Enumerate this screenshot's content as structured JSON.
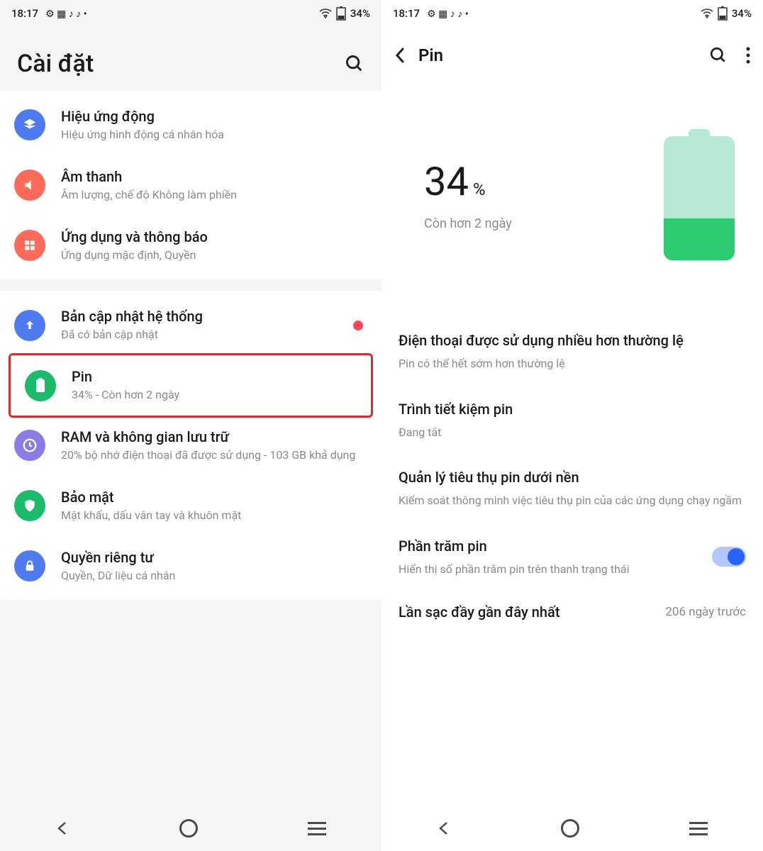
{
  "status": {
    "time": "18:17",
    "left_icons": [
      "gear",
      "grid",
      "tiktok",
      "tiktok",
      "dot"
    ],
    "right_icons": [
      "wifi",
      "battery"
    ],
    "battery_text": "34%"
  },
  "left_screen": {
    "title": "Cài đặt",
    "group1": [
      {
        "icon": "layers",
        "color": "#4e7cf0",
        "title": "Hiệu ứng động",
        "sub": "Hiệu ứng hình động cá nhân hóa"
      },
      {
        "icon": "speaker",
        "color": "#ff6b5b",
        "title": "Âm thanh",
        "sub": "Âm lượng, chế độ Không làm phiền"
      },
      {
        "icon": "apps",
        "color": "#ff6b5b",
        "title": "Ứng dụng và thông báo",
        "sub": "Ứng dụng mặc định, Quyền"
      }
    ],
    "group2": [
      {
        "icon": "update",
        "color": "#4e7cf0",
        "title": "Bản cập nhật hệ thống",
        "sub": "Đã có bản cập nhật",
        "badge": true
      },
      {
        "icon": "battery",
        "color": "#1abc6b",
        "title": "Pin",
        "sub": "34% - Còn hơn 2 ngày",
        "highlight": true
      },
      {
        "icon": "clock",
        "color": "#8c7ae6",
        "title": "RAM và không gian lưu trữ",
        "sub": "20% bộ nhớ điện thoại đã được sử dụng - 103 GB khả dụng"
      },
      {
        "icon": "shield",
        "color": "#1abc6b",
        "title": "Bảo mật",
        "sub": "Mật khẩu, dấu vân tay và khuôn mặt"
      },
      {
        "icon": "lock",
        "color": "#4e7cf0",
        "title": "Quyền riêng tư",
        "sub": "Quyền, Dữ liệu cá nhân"
      }
    ]
  },
  "right_screen": {
    "title": "Pin",
    "battery_percent": "34",
    "battery_percent_sign": "%",
    "estimate": "Còn hơn 2 ngày",
    "items": [
      {
        "title": "Điện thoại được sử dụng nhiều hơn thường lệ",
        "sub": "Pin có thể hết sớm hơn thường lệ"
      },
      {
        "title": "Trình tiết kiệm pin",
        "sub": "Đang tắt"
      },
      {
        "title": "Quản lý tiêu thụ pin dưới nền",
        "sub": "Kiểm soát thông minh việc tiêu thụ pin của các ứng dụng chạy ngầm"
      },
      {
        "title": "Phần trăm pin",
        "sub": "Hiển thị số phần trăm pin trên thanh trạng thái",
        "toggle": true
      }
    ],
    "last_charge": {
      "title": "Lần sạc đầy gần đây nhất",
      "value": "206 ngày trước"
    }
  }
}
